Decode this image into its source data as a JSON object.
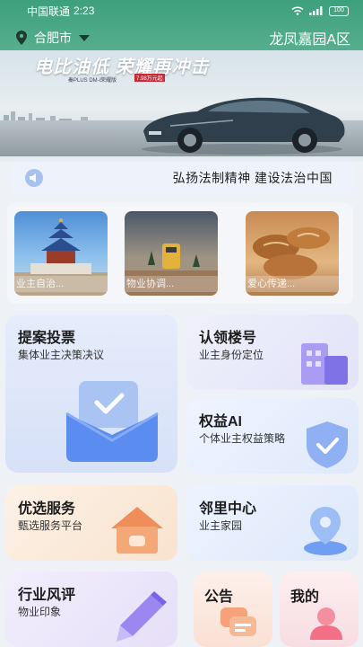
{
  "status": {
    "carrier": "中国联通",
    "time": "2:23",
    "battery": "100"
  },
  "location": {
    "city": "合肥市",
    "community": "龙凤嘉园A区"
  },
  "banner": {
    "slogan": "电比油低 荣耀再冲击",
    "model": "秦PLUS DM-i荣耀版",
    "price": "7.98万元起"
  },
  "notice": {
    "text": "弘扬法制精神 建设法治中国"
  },
  "gallery": [
    {
      "caption": "业主自治..."
    },
    {
      "caption": "物业协调..."
    },
    {
      "caption": "爱心传递..."
    }
  ],
  "tiles": {
    "proposal": {
      "title": "提案投票",
      "sub": "集体业主决策决议"
    },
    "building": {
      "title": "认领楼号",
      "sub": "业主身份定位"
    },
    "rights": {
      "title": "权益AI",
      "sub": "个体业主权益策略"
    },
    "service": {
      "title": "优选服务",
      "sub": "甄选服务平台"
    },
    "neighbor": {
      "title": "邻里中心",
      "sub": "业主家园"
    },
    "review": {
      "title": "行业风评",
      "sub": "物业印象"
    },
    "announce": {
      "title": "公告"
    },
    "mine": {
      "title": "我的"
    }
  },
  "colors": {
    "brand_green": "#3ea07e",
    "accent_blue": "#5b8df0"
  }
}
